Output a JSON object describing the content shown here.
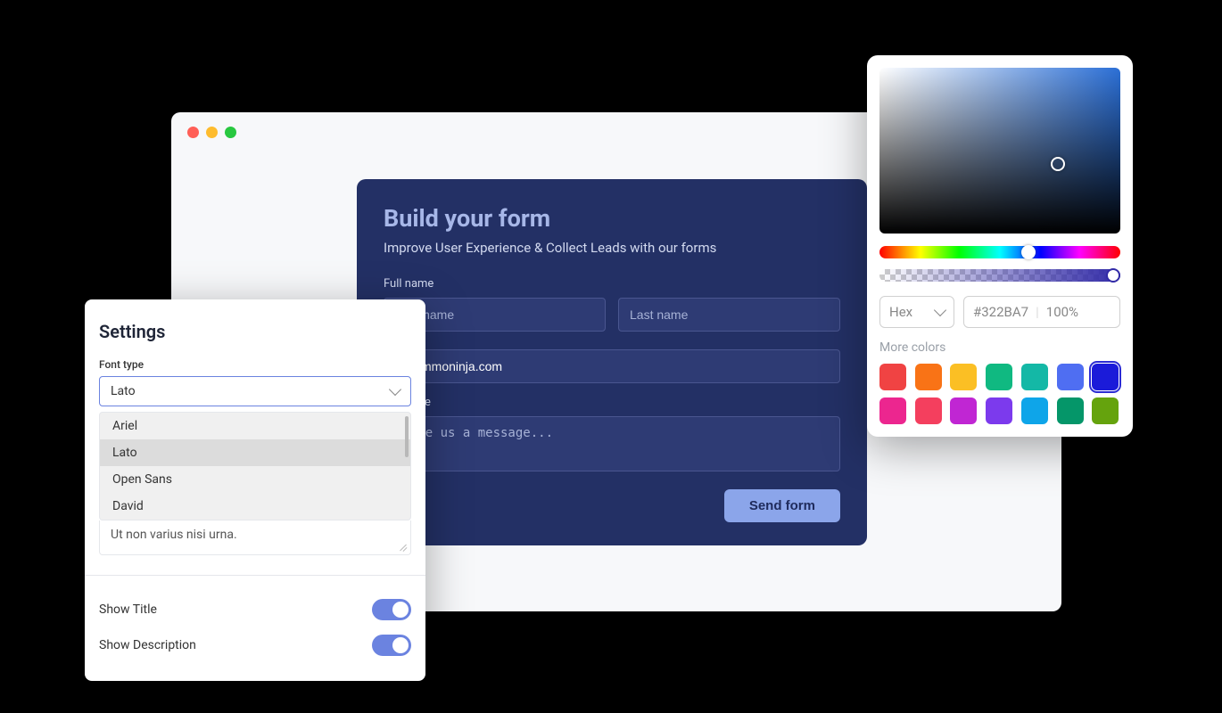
{
  "browser": {
    "form": {
      "title": "Build your form",
      "subtitle": "Improve User Experience & Collect Leads with our forms",
      "fullname_label": "Full name",
      "firstname_placeholder": "First name",
      "lastname_placeholder": "Last name",
      "email_label": "",
      "email_value": "@commoninja.com",
      "message_label": "Message",
      "message_placeholder": "Leave us a message...",
      "send_button": "Send form"
    }
  },
  "settings": {
    "title": "Settings",
    "font_type_label": "Font type",
    "font_selected": "Lato",
    "font_options": [
      "Ariel",
      "Lato",
      "Open Sans",
      "David"
    ],
    "note_text": "Ut non varius nisi urna.",
    "show_title_label": "Show Title",
    "show_title_on": true,
    "show_description_label": "Show Description",
    "show_description_on": true
  },
  "colorpicker": {
    "format_label": "Hex",
    "hex_value": "#322BA7",
    "opacity": "100%",
    "more_colors_label": "More colors",
    "swatches": [
      "#f04343",
      "#f97316",
      "#fbbf24",
      "#10b981",
      "#14b8a6",
      "#4f6ef2",
      "#1b1bd9",
      "#ec268f",
      "#f43f5e",
      "#c026d3",
      "#7c3aed",
      "#0ea5e9",
      "#059669",
      "#65a30d"
    ],
    "selected_swatch_index": 6
  }
}
